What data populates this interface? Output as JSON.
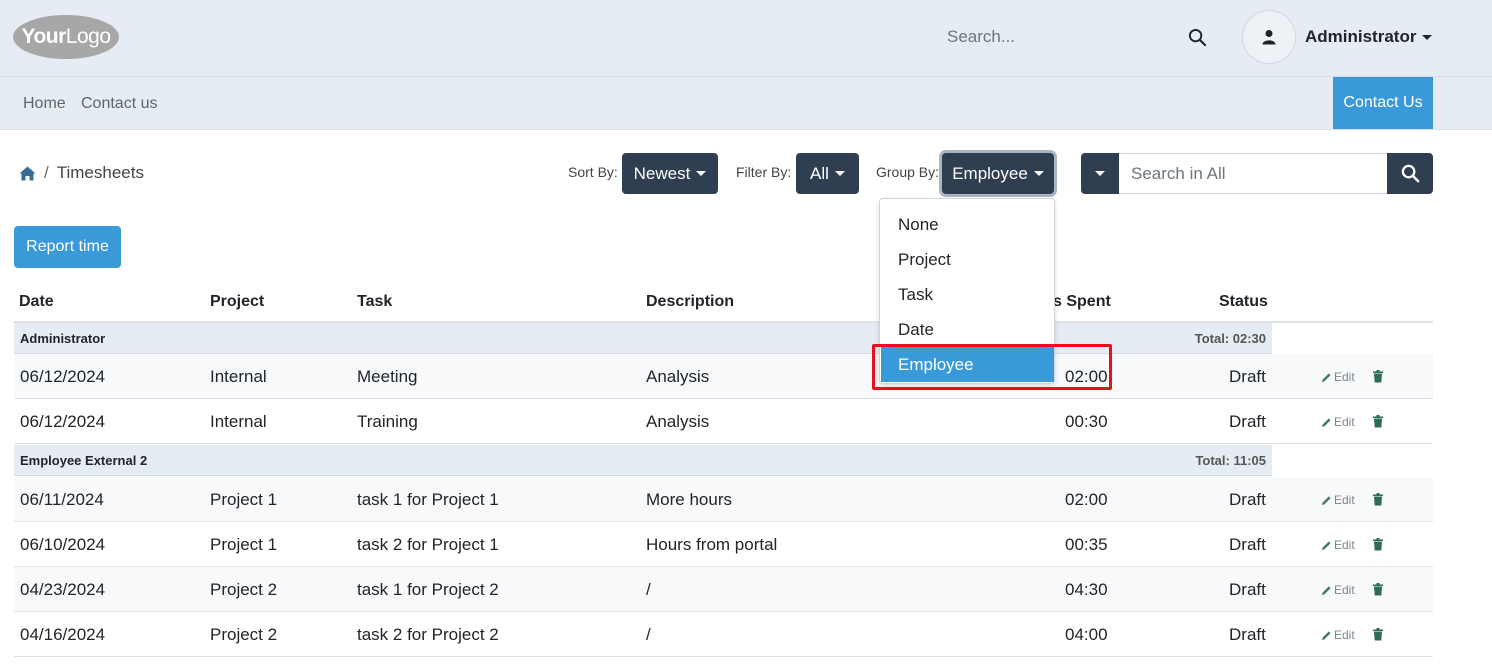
{
  "header": {
    "logo_bold": "Your",
    "logo_thin": "Logo",
    "search_placeholder": "Search...",
    "user_name": "Administrator"
  },
  "nav": {
    "items": [
      "Home",
      "Contact us"
    ],
    "contact_button": "Contact Us"
  },
  "breadcrumb": {
    "separator": "/",
    "current": "Timesheets"
  },
  "toolbar": {
    "sort_label": "Sort By:",
    "sort_value": "Newest",
    "filter_label": "Filter By:",
    "filter_value": "All",
    "group_label": "Group By:",
    "group_value": "Employee",
    "search_placeholder": "Search in All"
  },
  "group_by_menu": {
    "options": [
      "None",
      "Project",
      "Task",
      "Date",
      "Employee"
    ],
    "selected": "Employee"
  },
  "report_button": "Report time",
  "table": {
    "columns": [
      "Date",
      "Project",
      "Task",
      "Description",
      "s Spent",
      "Status"
    ],
    "edit_label": "Edit",
    "groups": [
      {
        "name": "Administrator",
        "total": "Total: 02:30",
        "rows": [
          {
            "date": "06/12/2024",
            "project": "Internal",
            "task": "Meeting",
            "description": "Analysis",
            "hours": "02:00",
            "status": "Draft"
          },
          {
            "date": "06/12/2024",
            "project": "Internal",
            "task": "Training",
            "description": "Analysis",
            "hours": "00:30",
            "status": "Draft"
          }
        ]
      },
      {
        "name": "Employee External 2",
        "total": "Total: 11:05",
        "rows": [
          {
            "date": "06/11/2024",
            "project": "Project 1",
            "task": "task 1 for Project 1",
            "description": "More hours",
            "hours": "02:00",
            "status": "Draft"
          },
          {
            "date": "06/10/2024",
            "project": "Project 1",
            "task": "task 2 for Project 1",
            "description": "Hours from portal",
            "hours": "00:35",
            "status": "Draft"
          },
          {
            "date": "04/23/2024",
            "project": "Project 2",
            "task": "task 1 for Project 2",
            "description": "/",
            "hours": "04:30",
            "status": "Draft"
          },
          {
            "date": "04/16/2024",
            "project": "Project 2",
            "task": "task 2 for Project 2",
            "description": "/",
            "hours": "04:00",
            "status": "Draft"
          }
        ]
      }
    ]
  },
  "colors": {
    "header_bg": "#e6ecf3",
    "primary_dark": "#2f3e50",
    "accent_blue": "#3a9ad9",
    "highlight_red": "#e8101a"
  }
}
